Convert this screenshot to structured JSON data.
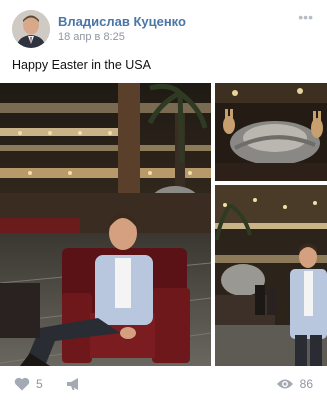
{
  "post": {
    "author": "Владислав Куценко",
    "date": "18 апр в 8:25",
    "text": "Happy Easter in the USA",
    "more_label": "•••"
  },
  "footer": {
    "likes": "5",
    "views": "86",
    "icons": [
      "heart-icon",
      "megaphone-icon",
      "eye-icon"
    ]
  },
  "colors": {
    "author_link": "#4a76a8",
    "meta_gray": "#8f96a0",
    "icon_gray": "#b7bdc5"
  }
}
